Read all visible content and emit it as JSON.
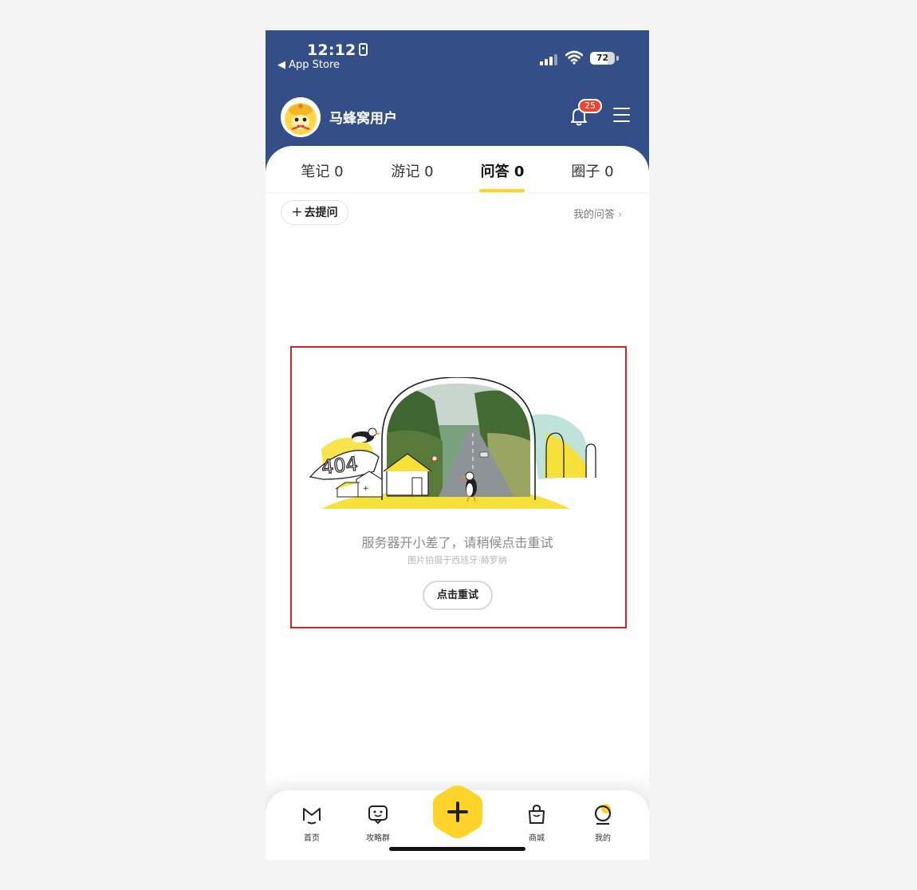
{
  "status_bar": {
    "time": "12:12",
    "back_app": "◀ App Store",
    "battery": "72"
  },
  "header": {
    "username": "马蜂窝用户",
    "notification_count": "25"
  },
  "tabs": [
    {
      "label": "笔记 0"
    },
    {
      "label": "游记 0"
    },
    {
      "label": "问答 0"
    },
    {
      "label": "圈子 0"
    }
  ],
  "active_tab": "问答 0",
  "toolbar": {
    "ask_label": "去提问",
    "my_qa_label": "我的问答"
  },
  "error": {
    "badge_text": "404",
    "title": "服务器开小差了，请稍候点击重试",
    "caption": "图片拍摄于西班牙·赫罗纳",
    "retry_label": "点击重试"
  },
  "bottom_nav": [
    {
      "label": "首页",
      "icon": "home-icon"
    },
    {
      "label": "攻略群",
      "icon": "chat-icon"
    },
    {
      "label": "商城",
      "icon": "shopping-bag-icon"
    },
    {
      "label": "我的",
      "icon": "profile-icon"
    }
  ],
  "colors": {
    "header_bg": "#344f87",
    "accent_yellow": "#ffd32a",
    "badge_red": "#f0452d",
    "highlight_border": "#d8232a"
  }
}
